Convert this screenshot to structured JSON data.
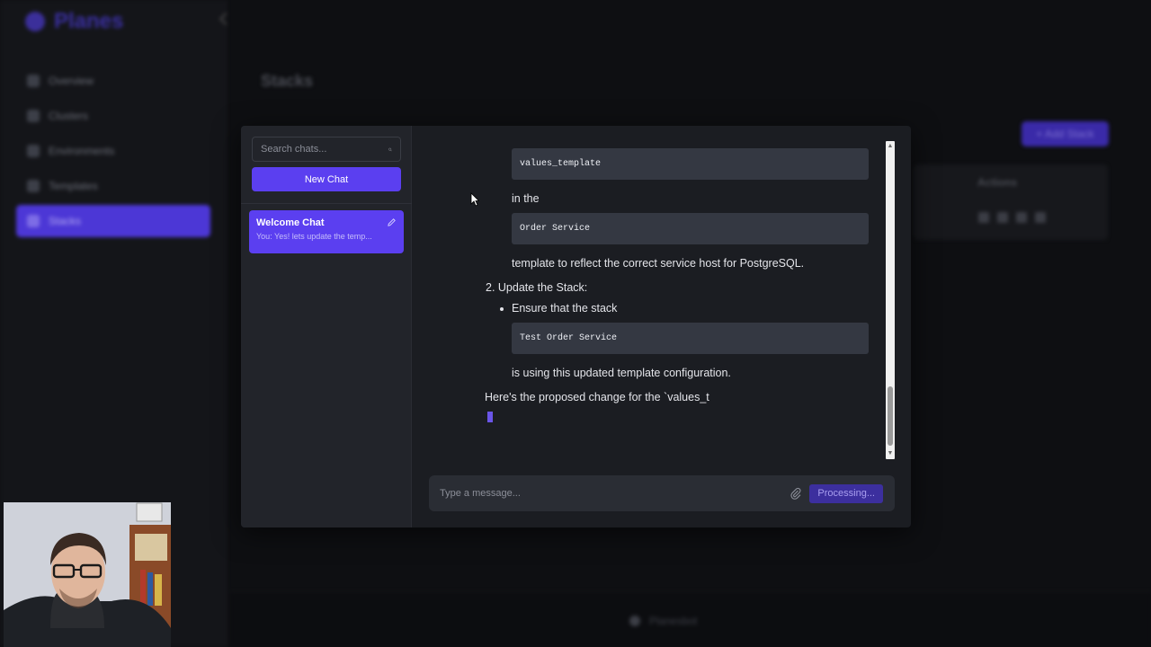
{
  "background_app": {
    "logo_text": "Planes",
    "nav": [
      "Overview",
      "Clusters",
      "Environments",
      "Templates",
      "Stacks"
    ],
    "active_nav": "Stacks",
    "page_title": "Stacks",
    "add_button": "+ Add Stack",
    "table_header_actions": "Actions",
    "footer_label": "Planesbot"
  },
  "chat_sidebar": {
    "search_placeholder": "Search chats...",
    "new_chat_label": "New Chat",
    "chats": [
      {
        "title": "Welcome Chat",
        "preview": "You: Yes! lets update the temp..."
      }
    ]
  },
  "messages": {
    "code_values_template": "values_template",
    "text_in_the": "in the",
    "code_order_service": "Order Service",
    "text_template_reflect": "template to reflect the correct service host for PostgreSQL.",
    "step2_heading": "2. Update the Stack:",
    "bullet_ensure": "Ensure that the stack",
    "code_test_order_service": "Test Order Service",
    "text_using_updated": "is using this updated template configuration.",
    "text_proposed_change": "Here's the proposed change for the `values_t"
  },
  "composer": {
    "placeholder": "Type a message...",
    "status_button": "Processing..."
  },
  "icons": {
    "search": "search-icon",
    "edit": "pencil-icon",
    "attach": "paperclip-icon"
  },
  "colors": {
    "accent": "#5b3ff0",
    "modal_bg": "#1b1d22",
    "sidebar_bg": "#22242a",
    "code_bg": "#343842"
  }
}
